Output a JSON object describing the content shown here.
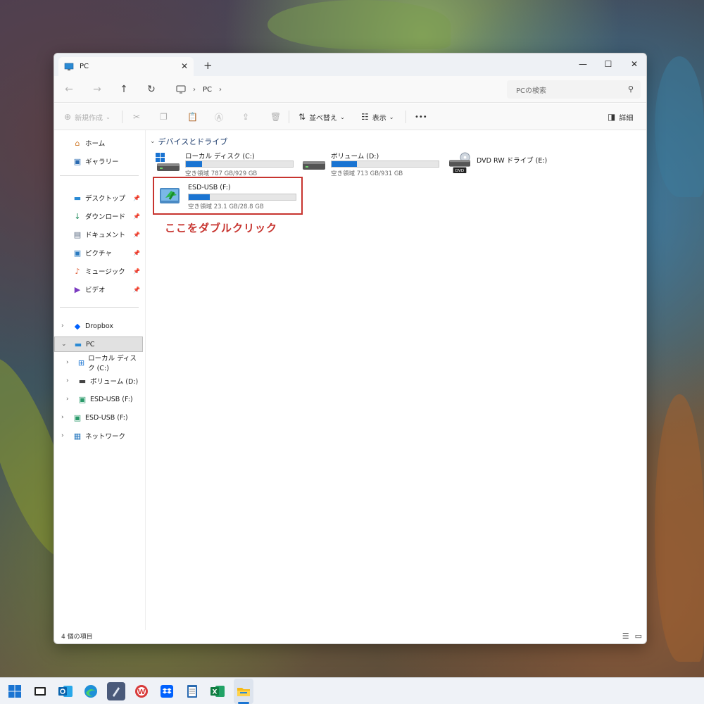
{
  "window": {
    "tab_title": "PC",
    "new_tab": "+",
    "controls": {
      "minimize": "—",
      "maximize": "☐",
      "close": "✕"
    }
  },
  "address": {
    "segments": [
      "PC"
    ],
    "search_placeholder": "PCの検索"
  },
  "toolbar": {
    "new": "新規作成",
    "sort": "並べ替え",
    "view": "表示",
    "more": "•••",
    "details": "詳細"
  },
  "sidebar": {
    "top": [
      {
        "label": "ホーム",
        "icon": "home-icon"
      },
      {
        "label": "ギャラリー",
        "icon": "gallery-icon"
      }
    ],
    "quick_access": [
      {
        "label": "デスクトップ",
        "icon": "desktop-icon"
      },
      {
        "label": "ダウンロード",
        "icon": "download-icon"
      },
      {
        "label": "ドキュメント",
        "icon": "document-icon"
      },
      {
        "label": "ピクチャ",
        "icon": "pictures-icon"
      },
      {
        "label": "ミュージック",
        "icon": "music-icon"
      },
      {
        "label": "ビデオ",
        "icon": "video-icon"
      }
    ],
    "tree": [
      {
        "label": "Dropbox",
        "icon": "dropbox-icon"
      },
      {
        "label": "PC",
        "icon": "pc-icon",
        "selected": true
      },
      {
        "label": "ローカル ディスク (C:)",
        "icon": "windows-drive-icon"
      },
      {
        "label": "ボリューム (D:)",
        "icon": "drive-icon"
      },
      {
        "label": "ESD-USB (F:)",
        "icon": "usb-drive-icon"
      },
      {
        "label": "ESD-USB (F:)",
        "icon": "usb-drive-icon"
      },
      {
        "label": "ネットワーク",
        "icon": "network-icon"
      }
    ]
  },
  "main": {
    "section_title": "デバイスとドライブ",
    "drives": [
      {
        "name": "ローカル ディスク (C:)",
        "space": "空き領域 787 GB/929 GB",
        "used_fraction": 0.153,
        "icon": "windows-drive-icon"
      },
      {
        "name": "ボリューム (D:)",
        "space": "空き領域 713 GB/931 GB",
        "used_fraction": 0.234,
        "icon": "drive-icon"
      },
      {
        "name": "DVD RW ドライブ (E:)",
        "icon": "dvd-drive-icon"
      },
      {
        "name": "ESD-USB (F:)",
        "space": "空き領域 23.1 GB/28.8 GB",
        "used_fraction": 0.198,
        "icon": "usb-setup-icon"
      }
    ],
    "annotation": "ここをダブルクリック",
    "annotation_color": "#c7342f"
  },
  "status": {
    "item_count": "4 個の項目"
  },
  "colors": {
    "accent": "#1a74d2",
    "highlight": "#c7342f"
  },
  "taskbar": {
    "items": [
      "start-icon",
      "task-view-icon",
      "outlook-icon",
      "edge-icon",
      "pen-app-icon",
      "wordpress-icon",
      "dropbox-icon",
      "notepad-icon",
      "excel-icon",
      "file-explorer-icon"
    ]
  }
}
